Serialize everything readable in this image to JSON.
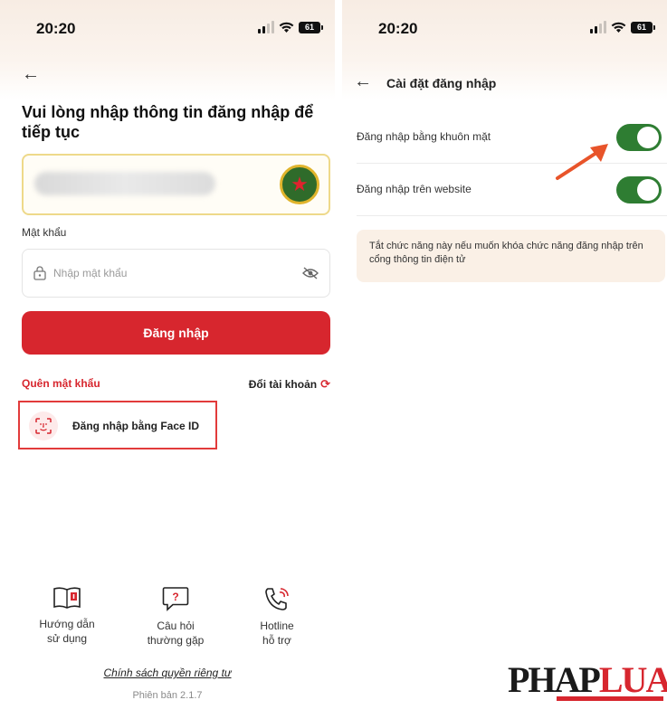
{
  "left": {
    "status": {
      "time": "20:20",
      "battery": "61"
    },
    "title": "Vui lòng nhập thông tin đăng nhập để tiếp tục",
    "password": {
      "label": "Mật khẩu",
      "placeholder": "Nhập mật khẩu"
    },
    "login_label": "Đăng nhập",
    "forgot_label": "Quên mật khẩu",
    "switch_label": "Đổi tài khoản",
    "faceid_label": "Đăng nhập bằng Face ID",
    "bottom": [
      {
        "line1": "Hướng dẫn",
        "line2": "sử dụng",
        "icon": "book-icon"
      },
      {
        "line1": "Câu hỏi",
        "line2": "thường gặp",
        "icon": "question-bubble-icon"
      },
      {
        "line1": "Hotline",
        "line2": "hỗ trợ",
        "icon": "phone-call-icon"
      }
    ],
    "privacy": "Chính sách quyền riêng tư",
    "version": "Phiên bản 2.1.7"
  },
  "right": {
    "status": {
      "time": "20:20",
      "battery": "61"
    },
    "title": "Cài đặt đăng nhập",
    "settings": [
      {
        "label": "Đăng nhập bằng khuôn mặt",
        "enabled": true
      },
      {
        "label": "Đăng nhập trên website",
        "enabled": true
      }
    ],
    "note": "Tắt chức năng này nếu muốn khóa chức năng đăng nhập trên cổng thông tin điện tử"
  },
  "logo": {
    "part1": "PHAP",
    "part2": "LUAT"
  },
  "colors": {
    "primary_red": "#d7262e",
    "toggle_green": "#2e7d32",
    "highlight_border": "#e23b3b",
    "note_bg": "#faf0e6"
  }
}
